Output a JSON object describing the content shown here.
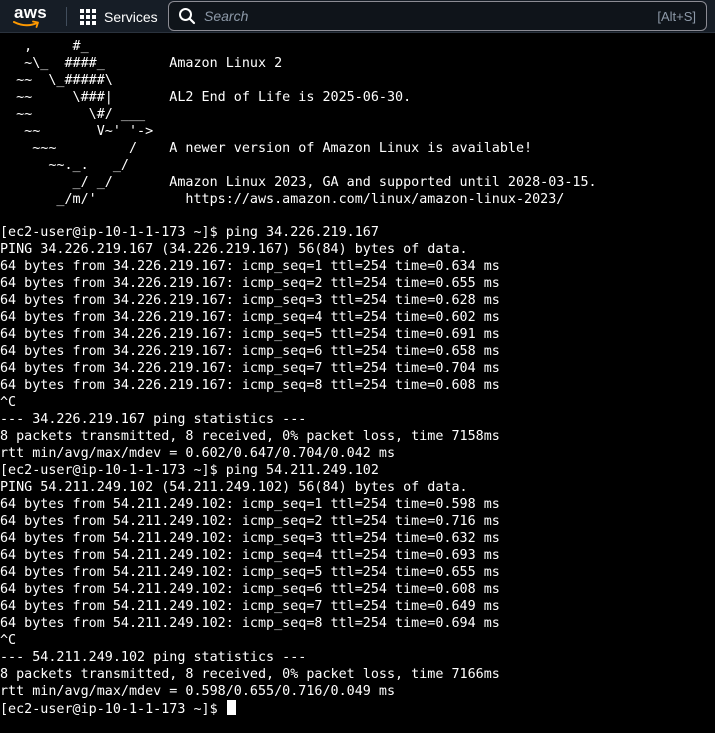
{
  "header": {
    "logo_text": "aws",
    "services_label": "Services",
    "search_placeholder": "Search",
    "search_shortcut": "[Alt+S]"
  },
  "terminal": {
    "banner": [
      "   ,     #_",
      "   ~\\_  ####_        Amazon Linux 2",
      "  ~~  \\_#####\\",
      "  ~~     \\###|       AL2 End of Life is 2025-06-30.",
      "  ~~       \\#/ ___",
      "   ~~       V~' '->",
      "    ~~~         /    A newer version of Amazon Linux is available!",
      "      ~~._.   _/",
      "         _/ _/       Amazon Linux 2023, GA and supported until 2028-03-15.",
      "       _/m/'           https://aws.amazon.com/linux/amazon-linux-2023/"
    ],
    "lines": [
      "[ec2-user@ip-10-1-1-173 ~]$ ping 34.226.219.167",
      "PING 34.226.219.167 (34.226.219.167) 56(84) bytes of data.",
      "64 bytes from 34.226.219.167: icmp_seq=1 ttl=254 time=0.634 ms",
      "64 bytes from 34.226.219.167: icmp_seq=2 ttl=254 time=0.655 ms",
      "64 bytes from 34.226.219.167: icmp_seq=3 ttl=254 time=0.628 ms",
      "64 bytes from 34.226.219.167: icmp_seq=4 ttl=254 time=0.602 ms",
      "64 bytes from 34.226.219.167: icmp_seq=5 ttl=254 time=0.691 ms",
      "64 bytes from 34.226.219.167: icmp_seq=6 ttl=254 time=0.658 ms",
      "64 bytes from 34.226.219.167: icmp_seq=7 ttl=254 time=0.704 ms",
      "64 bytes from 34.226.219.167: icmp_seq=8 ttl=254 time=0.608 ms",
      "^C",
      "--- 34.226.219.167 ping statistics ---",
      "8 packets transmitted, 8 received, 0% packet loss, time 7158ms",
      "rtt min/avg/max/mdev = 0.602/0.647/0.704/0.042 ms",
      "[ec2-user@ip-10-1-1-173 ~]$ ping 54.211.249.102",
      "PING 54.211.249.102 (54.211.249.102) 56(84) bytes of data.",
      "64 bytes from 54.211.249.102: icmp_seq=1 ttl=254 time=0.598 ms",
      "64 bytes from 54.211.249.102: icmp_seq=2 ttl=254 time=0.716 ms",
      "64 bytes from 54.211.249.102: icmp_seq=3 ttl=254 time=0.632 ms",
      "64 bytes from 54.211.249.102: icmp_seq=4 ttl=254 time=0.693 ms",
      "64 bytes from 54.211.249.102: icmp_seq=5 ttl=254 time=0.655 ms",
      "64 bytes from 54.211.249.102: icmp_seq=6 ttl=254 time=0.608 ms",
      "64 bytes from 54.211.249.102: icmp_seq=7 ttl=254 time=0.649 ms",
      "64 bytes from 54.211.249.102: icmp_seq=8 ttl=254 time=0.694 ms",
      "^C",
      "--- 54.211.249.102 ping statistics ---",
      "8 packets transmitted, 8 received, 0% packet loss, time 7166ms",
      "rtt min/avg/max/mdev = 0.598/0.655/0.716/0.049 ms"
    ],
    "prompt": "[ec2-user@ip-10-1-1-173 ~]$ "
  },
  "colors": {
    "header_bg": "#161d26",
    "terminal_bg": "#000000",
    "terminal_fg": "#ffffff",
    "logo_smile": "#ff9900"
  }
}
